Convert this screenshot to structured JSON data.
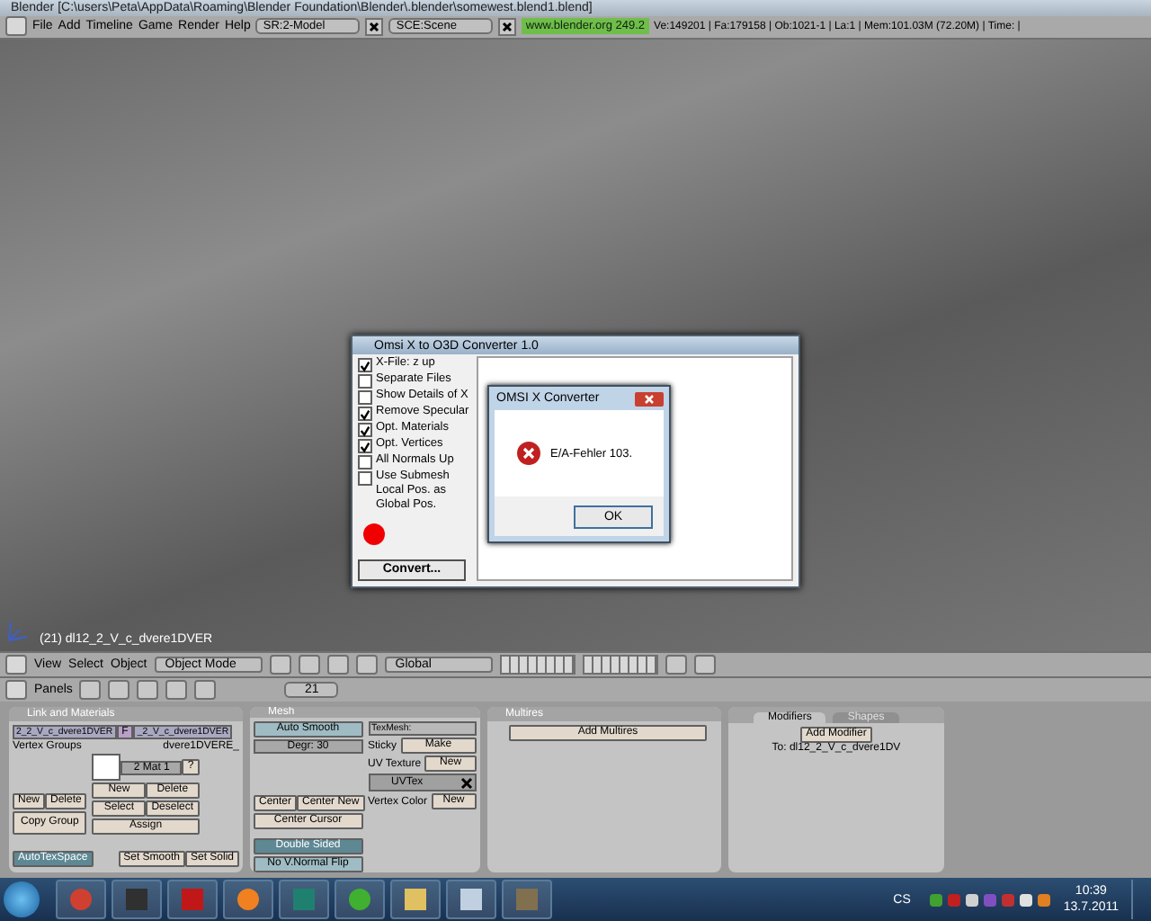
{
  "window": {
    "title": "Blender [C:\\users\\Peta\\AppData\\Roaming\\Blender Foundation\\Blender\\.blender\\somewest.blend1.blend]"
  },
  "menubar": {
    "menus": [
      "File",
      "Add",
      "Timeline",
      "Game",
      "Render",
      "Help"
    ],
    "screen": "SR:2-Model",
    "scene": "SCE:Scene",
    "site": "www.blender.org 249.2",
    "stats": "Ve:149201 | Fa:179158 | Ob:1021-1 | La:1 | Mem:101.03M (72.20M) | Time: |"
  },
  "viewport": {
    "object_label": "(21) dl12_2_V_c_dvere1DVER"
  },
  "converter": {
    "title": "Omsi X to O3D Converter 1.0",
    "options": [
      {
        "label": "X-File: z up",
        "checked": true
      },
      {
        "label": "Separate Files",
        "checked": false
      },
      {
        "label": "Show Details of X",
        "checked": false
      },
      {
        "label": "Remove Specular",
        "checked": true
      },
      {
        "label": "Opt. Materials",
        "checked": true
      },
      {
        "label": "Opt. Vertices",
        "checked": true
      },
      {
        "label": "All Normals Up",
        "checked": false
      },
      {
        "label": "Use Submesh Local Pos. as Global Pos.",
        "checked": false
      }
    ],
    "convert_button": "Convert..."
  },
  "error_dialog": {
    "title": "OMSI X Converter",
    "message": "E/A-Fehler 103.",
    "button": "OK"
  },
  "view3d_header": {
    "menus": [
      "View",
      "Select",
      "Object"
    ],
    "mode": "Object Mode",
    "orientation": "Global"
  },
  "buttons_header": {
    "menu": "Panels",
    "frame": "21"
  },
  "link_materials": {
    "title": "Link and Materials",
    "mesh_name": "2_2_V_c_dvere1DVER",
    "f_button": "F",
    "object_name": "_2_V_c_dvere1DVER",
    "vertex_groups": "Vertex Groups",
    "material_name": "dvere1DVERE_",
    "material_index": "2 Mat 1",
    "query": "?",
    "group_buttons": [
      "New",
      "Delete",
      "Copy Group"
    ],
    "material_buttons": [
      "New",
      "Delete",
      "Select",
      "Deselect",
      "Assign"
    ],
    "autotexspace": {
      "label": "AutoTexSpace",
      "on": true
    },
    "smooth_buttons": [
      "Set Smooth",
      "Set Solid"
    ]
  },
  "mesh": {
    "title": "Mesh",
    "auto_smooth": {
      "label": "Auto Smooth",
      "on": false
    },
    "degree": "Degr: 30",
    "center_buttons": [
      "Center",
      "Center New",
      "Center Cursor"
    ],
    "double_sided": {
      "label": "Double Sided",
      "on": true
    },
    "no_normal_flip": {
      "label": "No V.Normal Flip",
      "on": false
    },
    "texmesh": "TexMesh:",
    "sticky": "Sticky",
    "make": "Make",
    "uv_texture": "UV Texture",
    "uv_new": "New",
    "uv_layer": "UVTex",
    "vertex_color": "Vertex Color",
    "vc_new": "New"
  },
  "multires": {
    "title": "Multires",
    "add": "Add Multires"
  },
  "modifiers": {
    "tabs": [
      {
        "label": "Modifiers",
        "selected": true
      },
      {
        "label": "Shapes",
        "selected": false
      }
    ],
    "add": "Add Modifier",
    "target": "To: dl12_2_V_c_dvere1DV"
  },
  "taskbar": {
    "language": "CS",
    "time": "10:39",
    "date": "13.7.2011"
  }
}
